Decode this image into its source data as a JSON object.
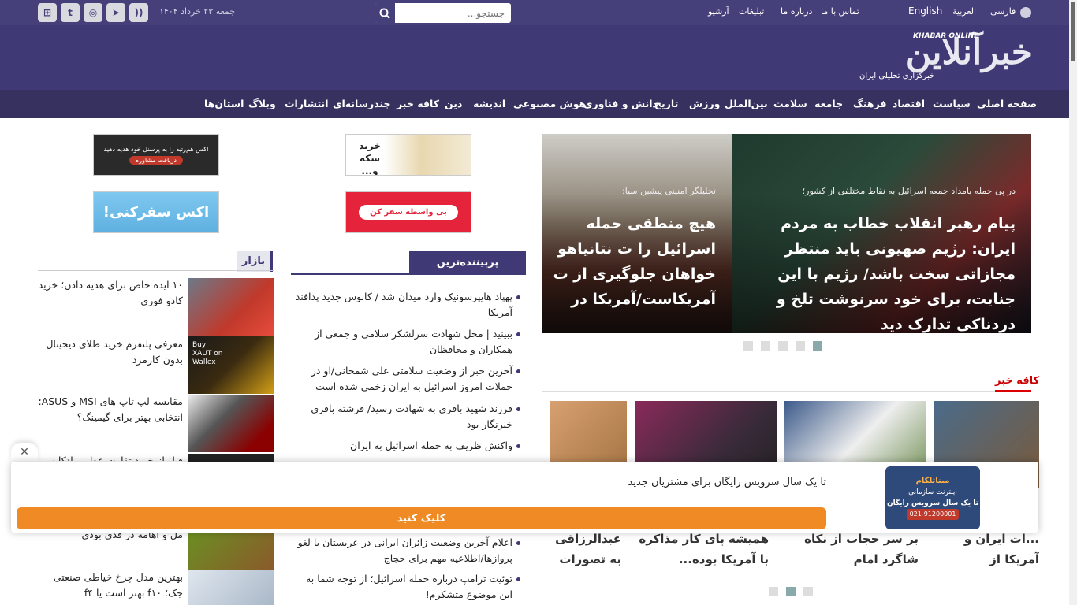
{
  "topbar": {
    "date": "جمعه ۲۳ خرداد ۱۴۰۴",
    "search_placeholder": "جستجو...",
    "links": [
      "آرشیو",
      "تبلیغات",
      "درباره ما",
      "تماس با ما"
    ],
    "languages": [
      "English",
      "العربية",
      "فارسی"
    ],
    "social_icons": [
      "app-icon",
      "twitter-icon",
      "instagram-icon",
      "telegram-icon",
      "rss-icon"
    ]
  },
  "logo": {
    "name": "خبرآنلاین",
    "name_en": "KHABAR ONLINE",
    "tagline": "خبرگزاری تحلیلی ایران"
  },
  "nav": [
    "صفحه اصلی",
    "سیاست",
    "اقتصاد",
    "فرهنگ",
    "جامعه",
    "سلامت",
    "بین‌الملل",
    "ورزش",
    "تاریخ",
    "دانش و فناوری",
    "هوش مصنوعی",
    "اندیشه",
    "دین",
    "کافه خبر",
    "چندرسانه‌ای",
    "انتشارات",
    "وبلاگ",
    "استان‌ها"
  ],
  "ads": {
    "ad1": "خرید سکه و...",
    "ad2": "بی واسطه سفر کن",
    "ad3": "اکس هم‌رتبه را به پرسنل خود هدیه دهید",
    "ad3_btn": "دریافت مشاوره",
    "ad4": "اکس سفرکنی!"
  },
  "slider": {
    "slide1_kicker": "در پی حمله بامداد جمعه اسرائیل به نقاط مختلفی از کشور؛",
    "slide1_title": "پیام رهبر انقلاب خطاب به مردم ایران: رژیم صهیونی باید منتظر مجازاتی سخت باشد/ رژیم با این جنایت، برای خود سرنوشت تلخ و دردناکی تدارک دید",
    "slide2_kicker": "تحلیلگر امنیتی پیشین سیا:",
    "slide2_title": "هیچ منطقی حمله اسرائیل را ت نتانیاهو خواهان جلوگیری از ت آمریکاست/آمریکا در تنگ بی شریک نشود"
  },
  "popular": {
    "title": "پربیننده‌ترین",
    "items": [
      "پهپاد هایپرسونیک وارد میدان شد / کابوس جدید پدافند آمریکا",
      "ببینید | محل شهادت سرلشکر سلامی و جمعی از همکاران و محافظان",
      "آخرین خبر از وضعیت سلامتی علی شمخانی/او در حملات امروز اسرائیل به ایران زخمی شده است",
      "فرزند شهید باقری به شهادت رسید/ فرشته باقری خبرنگار بود",
      "واکنش ظریف به حمله اسرائیل به ایران",
      "اعلام آخرین وضعیت زائران ایرانی در عربستان با لغو پروازها/اطلاعیه مهم برای حجاج",
      "توئیت ترامپ درباره حمله اسرائیل؛ از توجه شما به این موضوع متشکرم!"
    ]
  },
  "bazar": {
    "title": "بازار",
    "items": [
      "۱۰ ایده خاص برای هدیه دادن؛ خرید کادو فوری",
      "معرفی پلتفرم خرید طلای دیجیتال بدون کارمزد",
      "مقایسه لپ تاپ های MSI و ASUS؛ انتخابی بهتر برای گیمینگ؟",
      "قبل از خرید تفاوت عطر و ادکلن رو",
      "مل و اهامه در قدی بودی",
      "بهترین مدل چرخ خیاطی صنعتی جک؛ f۱۰ بهتر است یا f۴"
    ],
    "img2_text": "Buy XAUT on Wallex"
  },
  "cafe": {
    "title": "کافه خبر",
    "cards": [
      "...ات ایران و آمریکا از صغرزاده/...",
      "بر سر حجاب از نکاه شاگرد امام",
      "همیشه پای کار مذاکره با آمریکا بوده...",
      "عبدالرزاقی به تصورات موجو"
    ]
  },
  "popup": {
    "text": "تا یک سال سرویس رایگان برای مشتریان جدید",
    "button": "کلیک کنید",
    "ad_brand": "مبناتلکام",
    "ad_line1": "اینترنت سازمانی",
    "ad_line2": "تا یک سال سرویس رایگان",
    "ad_phone": "021-91200001"
  },
  "colors": {
    "primary": "#45407a",
    "header": "#3f3975",
    "nav": "#37315f",
    "accent": "#ef8a24",
    "cafe_red": "#d00000"
  }
}
